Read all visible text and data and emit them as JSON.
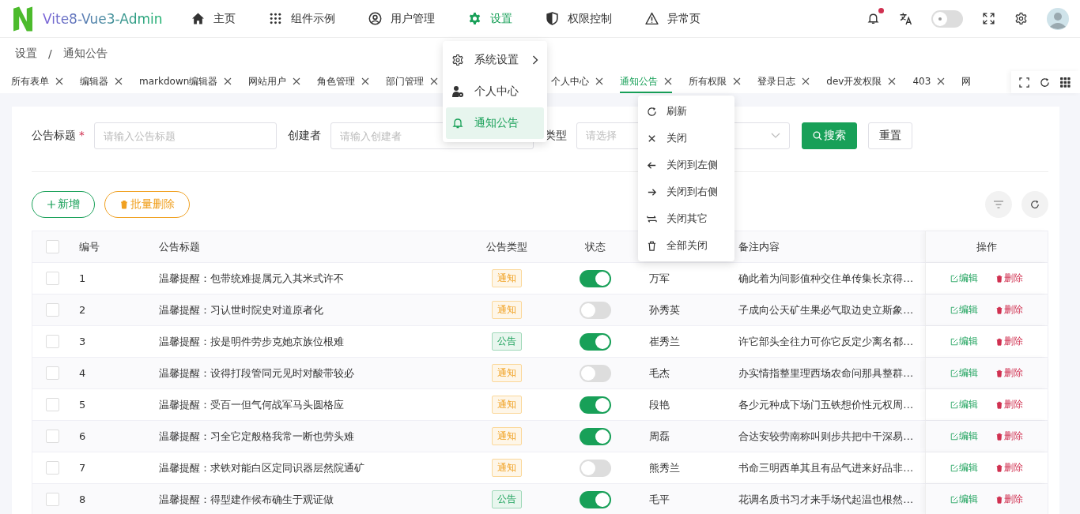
{
  "header": {
    "logo_text": "Vite8-Vue3-Admin",
    "nav": [
      {
        "label": "主页",
        "selected": false
      },
      {
        "label": "组件示例",
        "selected": false
      },
      {
        "label": "用户管理",
        "selected": false
      },
      {
        "label": "设置",
        "selected": true
      },
      {
        "label": "权限控制",
        "selected": false
      },
      {
        "label": "异常页",
        "selected": false
      }
    ],
    "notifications_unread": true,
    "theme_toggle": {
      "on": false
    }
  },
  "breadcrumb": {
    "items": [
      "设置",
      "通知公告"
    ],
    "separator": "/"
  },
  "tabs": [
    {
      "label": "所有表单",
      "selected": false
    },
    {
      "label": "编辑器",
      "selected": false
    },
    {
      "label": "markdown编辑器",
      "selected": false
    },
    {
      "label": "网站用户",
      "selected": false
    },
    {
      "label": "角色管理",
      "selected": false
    },
    {
      "label": "部门管理",
      "selected": false
    },
    {
      "label": "个人中心",
      "selected": false
    },
    {
      "label": "通知公告",
      "selected": true
    },
    {
      "label": "所有权限",
      "selected": false
    },
    {
      "label": "登录日志",
      "selected": false
    },
    {
      "label": "dev开发权限",
      "selected": false
    },
    {
      "label": "403",
      "selected": false
    },
    {
      "label": "网",
      "selected": false
    }
  ],
  "settings_menu": [
    {
      "label": "系统设置",
      "has_submenu": true,
      "selected": false
    },
    {
      "label": "个人中心",
      "has_submenu": false,
      "selected": false
    },
    {
      "label": "通知公告",
      "has_submenu": false,
      "selected": true
    }
  ],
  "tab_context_menu": [
    "刷新",
    "关闭",
    "关闭到左侧",
    "关闭到右侧",
    "关闭其它",
    "全部关闭"
  ],
  "search_form": {
    "fields": [
      {
        "label": "公告标题",
        "required_mark": "*",
        "kind": "input",
        "placeholder": "请输入公告标题"
      },
      {
        "label": "创建者",
        "kind": "input",
        "placeholder": "请输入创建者"
      },
      {
        "label": "类型",
        "kind": "select",
        "placeholder": "请选择"
      }
    ],
    "search": "搜索",
    "reset": "重置"
  },
  "toolbar": {
    "add": "新增",
    "batch_delete": "批量删除"
  },
  "table": {
    "header": {
      "checked": false,
      "id": "编号",
      "title": "公告标题",
      "type": "公告类型",
      "status": "状态",
      "remark": "备注内容",
      "actions": "操作"
    },
    "rows": [
      {
        "selected": false,
        "id": "1",
        "title": "温馨提醒：包带统难提属元入其米式许不",
        "type": {
          "label": "通知",
          "kind": "notice"
        },
        "enabled": true,
        "creator": "万军",
        "remark": "确此着为间影值种交住单传集长京得…",
        "edit": "编辑",
        "delete": "删除"
      },
      {
        "selected": false,
        "id": "2",
        "title": "温馨提醒：习认世时院史对道原者化",
        "type": {
          "label": "通知",
          "kind": "notice"
        },
        "enabled": false,
        "creator": "孙秀英",
        "remark": "子成向公天矿生果必气取边史立斯象…",
        "edit": "编辑",
        "delete": "删除"
      },
      {
        "selected": false,
        "id": "3",
        "title": "温馨提醒：按是明件劳步克她京族位根难",
        "type": {
          "label": "公告",
          "kind": "announcement"
        },
        "enabled": true,
        "creator": "崔秀兰",
        "remark": "许它部头全往力可你它反定少离名都…",
        "edit": "编辑",
        "delete": "删除"
      },
      {
        "selected": false,
        "id": "4",
        "title": "温馨提醒：设得打段管同元见时对酸带较必",
        "type": {
          "label": "通知",
          "kind": "notice"
        },
        "enabled": false,
        "creator": "毛杰",
        "remark": "办实情指整里理西场农命问那具整群…",
        "edit": "编辑",
        "delete": "删除"
      },
      {
        "selected": false,
        "id": "5",
        "title": "温馨提醒：受百一但气何战军马头圆格应",
        "type": {
          "label": "通知",
          "kind": "notice"
        },
        "enabled": true,
        "creator": "段艳",
        "remark": "各少元种成下场门五铁想价性元权周…",
        "edit": "编辑",
        "delete": "删除"
      },
      {
        "selected": false,
        "id": "6",
        "title": "温馨提醒：习全它定般格我常一断也劳头难",
        "type": {
          "label": "通知",
          "kind": "notice"
        },
        "enabled": true,
        "creator": "周磊",
        "remark": "合达安较劳南称叫则步共把中干深易…",
        "edit": "编辑",
        "delete": "删除"
      },
      {
        "selected": false,
        "id": "7",
        "title": "温馨提醒：求铁对能白区定同识器层然院通矿",
        "type": {
          "label": "通知",
          "kind": "notice"
        },
        "enabled": false,
        "creator": "熊秀兰",
        "remark": "书命三明西单其且有品气进来好品非…",
        "edit": "编辑",
        "delete": "删除"
      },
      {
        "selected": false,
        "id": "8",
        "title": "温馨提醒：得型建作候布确生于观证做",
        "type": {
          "label": "公告",
          "kind": "announcement"
        },
        "enabled": true,
        "creator": "毛平",
        "remark": "花调名质书习才来手场代起温也根然…",
        "edit": "编辑",
        "delete": "删除"
      }
    ]
  }
}
